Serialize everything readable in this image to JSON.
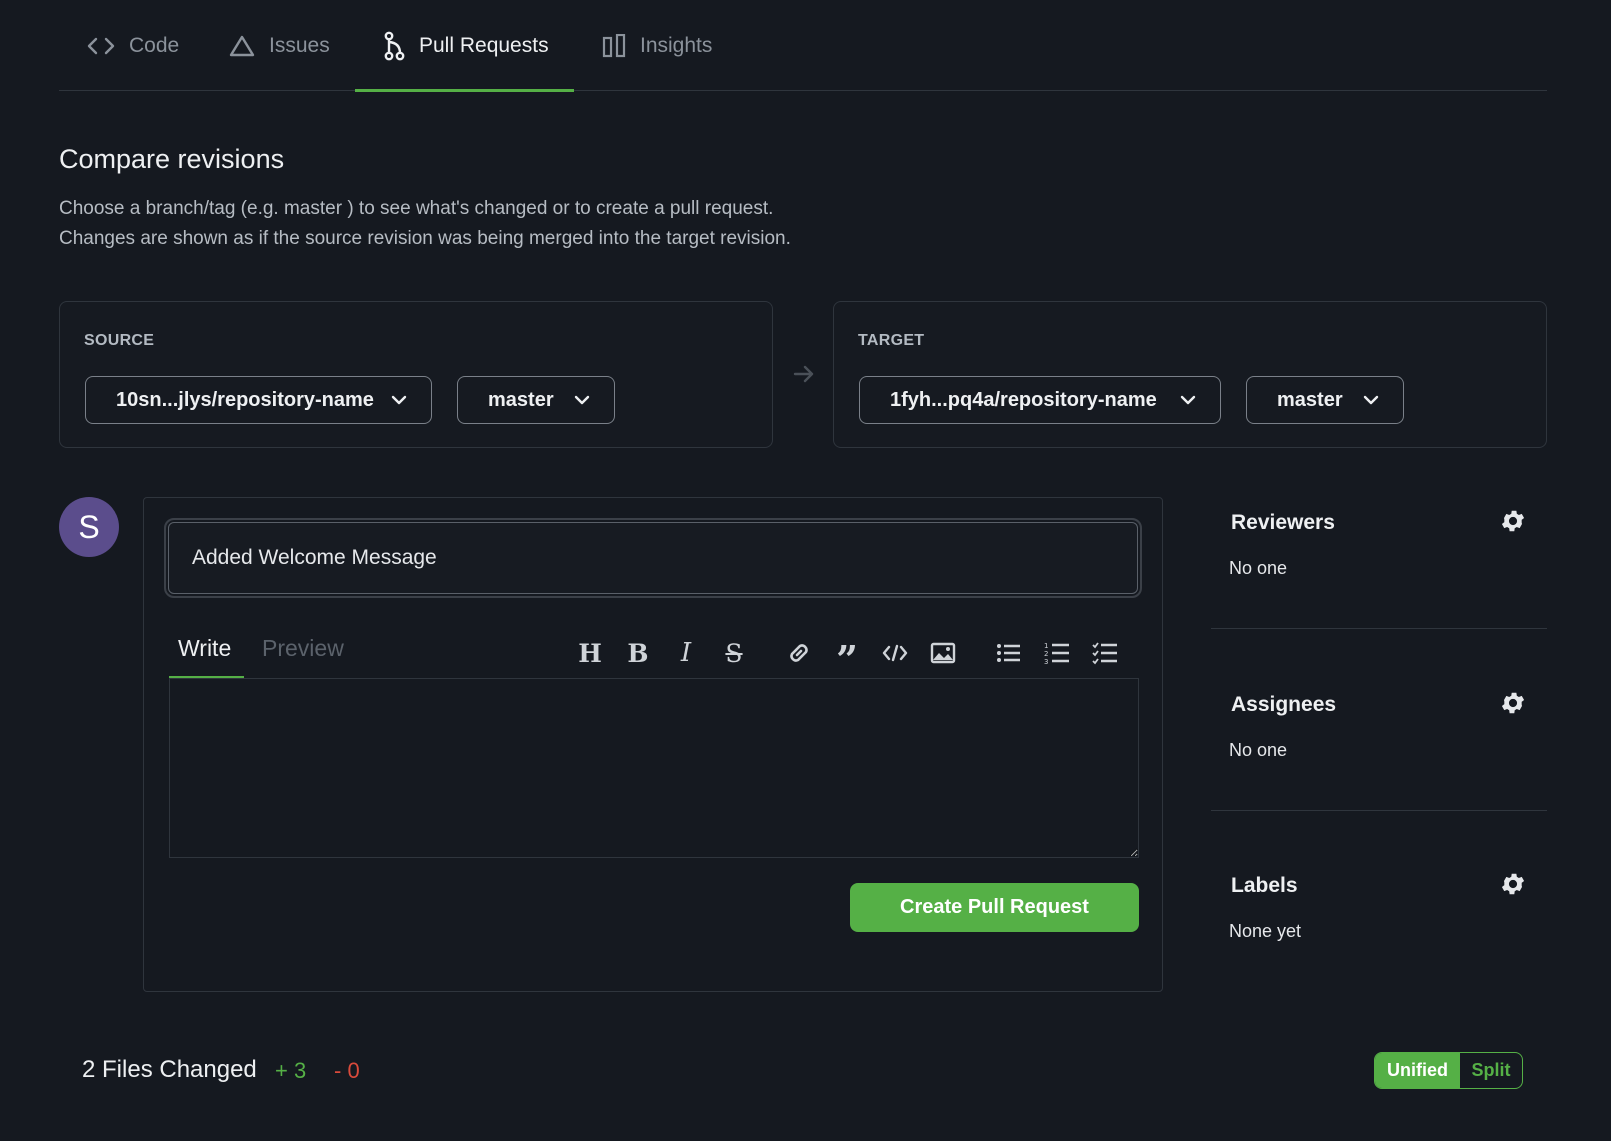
{
  "tabs": [
    {
      "label": "Code",
      "icon": "code-icon"
    },
    {
      "label": "Issues",
      "icon": "warning-triangle-icon"
    },
    {
      "label": "Pull Requests",
      "icon": "pull-request-icon"
    },
    {
      "label": "Insights",
      "icon": "insights-bars-icon"
    }
  ],
  "active_tab": "Pull Requests",
  "compare": {
    "title": "Compare revisions",
    "desc_line1": "Choose a branch/tag (e.g. master ) to see what's changed or to create a pull request.",
    "desc_line2": "Changes are shown as if the source revision was being merged into the target revision.",
    "source": {
      "label": "SOURCE",
      "repo": "10sn...jlys/repository-name",
      "branch": "master"
    },
    "target": {
      "label": "TARGET",
      "repo": "1fyh...pq4a/repository-name",
      "branch": "master"
    }
  },
  "avatar": {
    "initial": "S",
    "color": "#5b4d8c"
  },
  "editor": {
    "title_value": "Added Welcome Message",
    "write_tab": "Write",
    "preview_tab": "Preview",
    "body_value": "",
    "create_button": "Create Pull Request"
  },
  "sidebar": {
    "reviewers": {
      "title": "Reviewers",
      "value": "No one"
    },
    "assignees": {
      "title": "Assignees",
      "value": "No one"
    },
    "labels": {
      "title": "Labels",
      "value": "None yet"
    }
  },
  "footer": {
    "files_changed": "2 Files Changed",
    "additions": "+ 3",
    "deletions": "- 0",
    "view_unified": "Unified",
    "view_split": "Split"
  },
  "colors": {
    "accent": "#55b046",
    "deletion": "#d94a3b",
    "background": "#151920"
  }
}
